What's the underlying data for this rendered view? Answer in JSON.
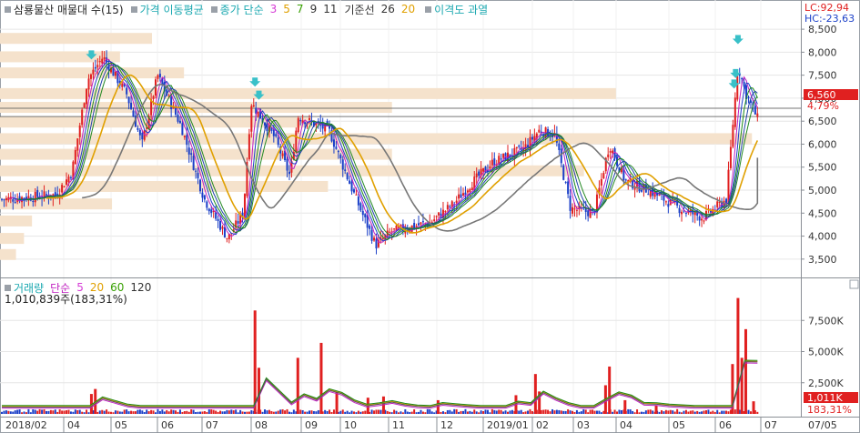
{
  "price_legend": {
    "title": "삼룡물산 매물대 수(15)",
    "ma_label": "가격 이동평균",
    "ma_type": "종가 단순",
    "ma_periods": [
      "3",
      "5",
      "7",
      "9",
      "11"
    ],
    "ma_period_colors": [
      "#d63bd6",
      "#e0a000",
      "#37a000",
      "#333333",
      "#333333"
    ],
    "base_label": "기준선",
    "base_values": [
      "26",
      "20"
    ],
    "base_colors": [
      "#333333",
      "#e0a000"
    ],
    "disparity_label": "이격도 과열"
  },
  "volume_legend": {
    "title": "거래량",
    "ma_type": "단순",
    "periods": [
      "5",
      "20",
      "60",
      "120"
    ],
    "period_colors": [
      "#d63bd6",
      "#e0a000",
      "#37a000",
      "#333333"
    ],
    "current": "1,010,839주(183,31%)"
  },
  "indicators": {
    "lc": "LC:92,94",
    "hc": "HC:-23,63"
  },
  "current_price": {
    "value": "6,560",
    "change": "4,79%"
  },
  "current_volume": {
    "value": "1,011K",
    "change": "183,31%"
  },
  "price_axis_labels": [
    "8,500",
    "8,000",
    "7,500",
    "7,000",
    "6,500",
    "6,000",
    "5,500",
    "5,000",
    "4,500",
    "4,000",
    "3,500"
  ],
  "volume_axis_labels": [
    "7,500K",
    "5,000K",
    "2,500K"
  ],
  "date_labels": [
    "2018/02",
    "04",
    "05",
    "06",
    "07",
    "08",
    "09",
    "10",
    "11",
    "12",
    "2019/01",
    "02",
    "03",
    "04",
    "05",
    "06",
    "07",
    "07/05"
  ],
  "colors": {
    "up": "#e02020",
    "down": "#1a3fc8",
    "profile": "#f5e2cc",
    "ma_blue": "#1a3fc8",
    "ma_green": "#1a8a1a",
    "ma_magenta": "#c020c0",
    "baseline": "#777777",
    "ma_gold": "#e0a000",
    "arrow": "#39c0c8"
  },
  "chart_data": {
    "type": "candlestick",
    "price_range": [
      3200,
      8700
    ],
    "price_ticks": [
      3500,
      4000,
      4500,
      5000,
      5500,
      6000,
      6500,
      7000,
      7500,
      8000,
      8500
    ],
    "volume_range": [
      0,
      10000
    ],
    "volume_ticks": [
      2500,
      5000,
      7500
    ],
    "volume_unit": "K",
    "current_price": 6560,
    "current_volume_k": 1011,
    "month_boundaries": [
      "2018/02",
      "04",
      "05",
      "06",
      "07",
      "08",
      "09",
      "10",
      "11",
      "12",
      "2019/01",
      "02",
      "03",
      "04",
      "05",
      "06",
      "07"
    ],
    "price_keyframes": [
      [
        0,
        4800
      ],
      [
        0.07,
        4900
      ],
      [
        0.09,
        5400
      ],
      [
        0.11,
        7400
      ],
      [
        0.13,
        7900
      ],
      [
        0.16,
        7100
      ],
      [
        0.18,
        6000
      ],
      [
        0.2,
        7500
      ],
      [
        0.23,
        6400
      ],
      [
        0.26,
        4800
      ],
      [
        0.29,
        3950
      ],
      [
        0.31,
        4500
      ],
      [
        0.32,
        6900
      ],
      [
        0.35,
        6150
      ],
      [
        0.37,
        5300
      ],
      [
        0.38,
        6600
      ],
      [
        0.42,
        6300
      ],
      [
        0.45,
        5000
      ],
      [
        0.48,
        3800
      ],
      [
        0.5,
        4100
      ],
      [
        0.55,
        4300
      ],
      [
        0.58,
        4700
      ],
      [
        0.6,
        5100
      ],
      [
        0.63,
        5600
      ],
      [
        0.67,
        5900
      ],
      [
        0.69,
        6300
      ],
      [
        0.71,
        6200
      ],
      [
        0.73,
        4600
      ],
      [
        0.76,
        4500
      ],
      [
        0.78,
        6000
      ],
      [
        0.8,
        5200
      ],
      [
        0.83,
        5000
      ],
      [
        0.87,
        4600
      ],
      [
        0.9,
        4400
      ],
      [
        0.93,
        4800
      ],
      [
        0.945,
        7700
      ],
      [
        0.955,
        7100
      ],
      [
        0.97,
        6560
      ]
    ],
    "volume_profile_rows": [
      {
        "price": 8300,
        "width": 0.19
      },
      {
        "price": 7900,
        "width": 0.15
      },
      {
        "price": 7550,
        "width": 0.23
      },
      {
        "price": 7100,
        "width": 0.77
      },
      {
        "price": 6800,
        "width": 0.49
      },
      {
        "price": 6480,
        "width": 0.39
      },
      {
        "price": 6120,
        "width": 0.94
      },
      {
        "price": 5780,
        "width": 0.49
      },
      {
        "price": 5420,
        "width": 0.73
      },
      {
        "price": 5080,
        "width": 0.41
      },
      {
        "price": 4700,
        "width": 0.14
      },
      {
        "price": 4330,
        "width": 0.04
      },
      {
        "price": 3950,
        "width": 0.03
      },
      {
        "price": 3600,
        "width": 0.02
      }
    ],
    "volume_spikes": [
      {
        "pos": 0.115,
        "value": 1600
      },
      {
        "pos": 0.12,
        "value": 2000
      },
      {
        "pos": 0.325,
        "value": 8300
      },
      {
        "pos": 0.33,
        "value": 3700
      },
      {
        "pos": 0.38,
        "value": 4500
      },
      {
        "pos": 0.41,
        "value": 5700
      },
      {
        "pos": 0.43,
        "value": 1800
      },
      {
        "pos": 0.47,
        "value": 1300
      },
      {
        "pos": 0.49,
        "value": 1400
      },
      {
        "pos": 0.56,
        "value": 1100
      },
      {
        "pos": 0.66,
        "value": 1500
      },
      {
        "pos": 0.685,
        "value": 3200
      },
      {
        "pos": 0.69,
        "value": 1800
      },
      {
        "pos": 0.775,
        "value": 2300
      },
      {
        "pos": 0.78,
        "value": 3800
      },
      {
        "pos": 0.8,
        "value": 1100
      },
      {
        "pos": 0.84,
        "value": 700
      },
      {
        "pos": 0.938,
        "value": 4000
      },
      {
        "pos": 0.945,
        "value": 9300
      },
      {
        "pos": 0.95,
        "value": 4500
      },
      {
        "pos": 0.955,
        "value": 6800
      },
      {
        "pos": 0.965,
        "value": 1011
      }
    ],
    "signal_arrows": [
      0.115,
      0.325,
      0.33,
      0.94,
      0.942,
      0.945
    ]
  }
}
